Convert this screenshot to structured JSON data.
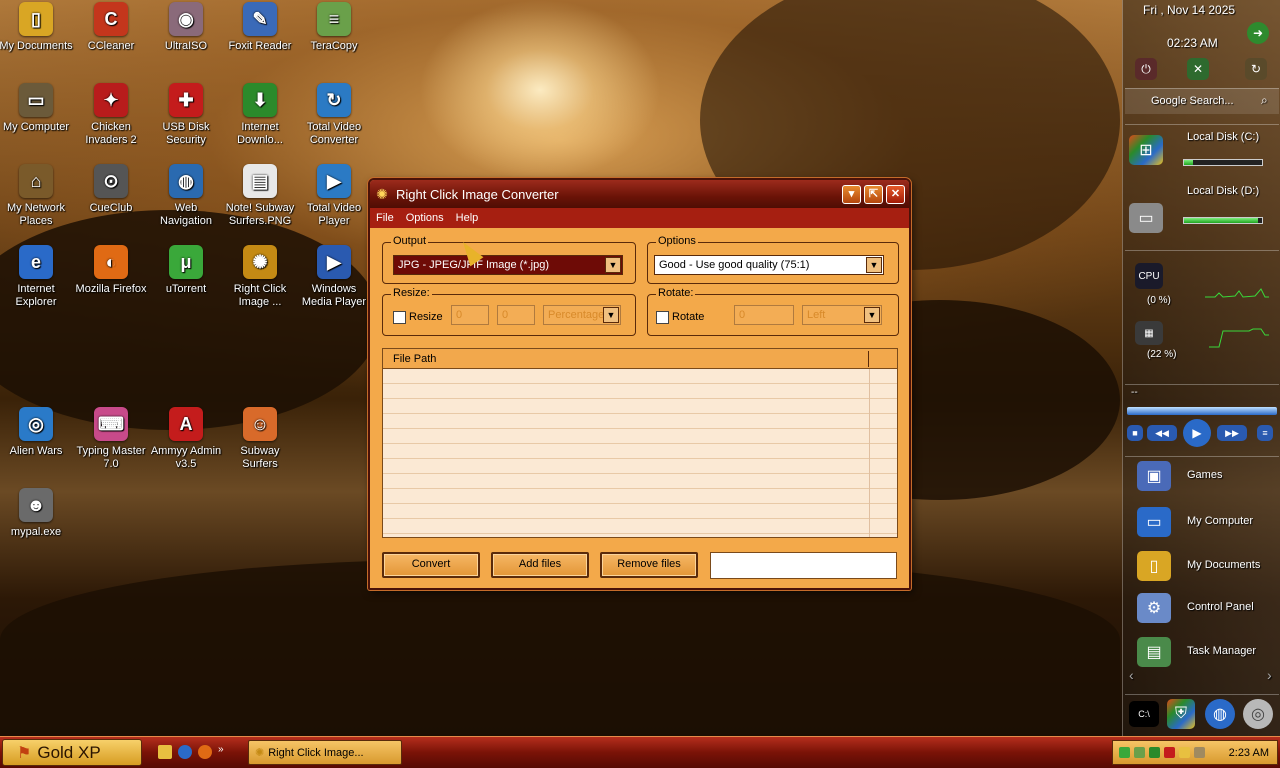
{
  "desktop": {
    "icons": [
      {
        "label": "My Documents",
        "glyph": "▯",
        "color": "#d9a624"
      },
      {
        "label": "CCleaner",
        "glyph": "C",
        "color": "#c4361c"
      },
      {
        "label": "UltraISO",
        "glyph": "◉",
        "color": "#8a6a7a"
      },
      {
        "label": "Foxit Reader",
        "glyph": "✎",
        "color": "#3a6ab8"
      },
      {
        "label": "TeraCopy",
        "glyph": "≡",
        "color": "#6aa04a"
      },
      {
        "label": "My Computer",
        "glyph": "▭",
        "color": "#6b5a3a"
      },
      {
        "label": "Chicken Invaders 2",
        "glyph": "✦",
        "color": "#b81c1c"
      },
      {
        "label": "USB Disk Security",
        "glyph": "✚",
        "color": "#c41c1c"
      },
      {
        "label": "Internet Downlo...",
        "glyph": "⬇",
        "color": "#2b8a2b"
      },
      {
        "label": "Total Video Converter",
        "glyph": "↻",
        "color": "#2b7ac4"
      },
      {
        "label": "My Network Places",
        "glyph": "⌂",
        "color": "#7a5a2a"
      },
      {
        "label": "CueClub",
        "glyph": "⊙",
        "color": "#555555"
      },
      {
        "label": "Web Navigation",
        "glyph": "◍",
        "color": "#2a6ab0"
      },
      {
        "label": "Note! Subway Surfers.PNG",
        "glyph": "▤",
        "color": "#e8e8e8"
      },
      {
        "label": "Total Video Player",
        "glyph": "▶",
        "color": "#2b7ac4"
      },
      {
        "label": "Internet Explorer",
        "glyph": "e",
        "color": "#2a6ac8"
      },
      {
        "label": "Mozilla Firefox",
        "glyph": "◐",
        "color": "#e06a14"
      },
      {
        "label": "uTorrent",
        "glyph": "μ",
        "color": "#3aa83a"
      },
      {
        "label": "Right Click Image ...",
        "glyph": "✺",
        "color": "#c48a14"
      },
      {
        "label": "Windows Media Player",
        "glyph": "▶",
        "color": "#2a5ab0"
      },
      {
        "label": "Alien Wars",
        "glyph": "◎",
        "color": "#2a7ac8"
      },
      {
        "label": "Typing Master 7.0",
        "glyph": "⌨",
        "color": "#c84a8a"
      },
      {
        "label": "Ammyy Admin v3.5",
        "glyph": "A",
        "color": "#c41c1c"
      },
      {
        "label": "Subway Surfers",
        "glyph": "☺",
        "color": "#d86a2a"
      },
      {
        "label": "mypal.exe",
        "glyph": "☻",
        "color": "#6a6a6a"
      }
    ]
  },
  "dialog": {
    "title": "Right Click Image Converter",
    "title_buttons": {
      "minimize": "▾",
      "maximize": "⇱",
      "close": "✕"
    },
    "menu": [
      "File",
      "Options",
      "Help"
    ],
    "output": {
      "legend": "Output",
      "value": "JPG - JPEG/JFIF Image (*.jpg)"
    },
    "options": {
      "legend": "Options",
      "value": "Good - Use good quality (75:1)"
    },
    "resize": {
      "legend": "Resize:",
      "checkbox_label": "Resize",
      "width": "0",
      "height": "0",
      "mode": "Percentage"
    },
    "rotate": {
      "legend": "Rotate:",
      "checkbox_label": "Rotate",
      "angle": "0",
      "direction": "Left"
    },
    "table": {
      "header": "File Path",
      "row_count": 11
    },
    "buttons": {
      "convert": "Convert",
      "add": "Add files",
      "remove": "Remove files"
    }
  },
  "sidebar": {
    "date": "Fri , Nov 14 2025",
    "time": "02:23 AM",
    "search_placeholder": "Google Search...",
    "disks": [
      {
        "label": "Local Disk (C:)",
        "fill": 0.12
      },
      {
        "label": "Local Disk (D:)",
        "fill": 0.95
      }
    ],
    "cpu": "(0 %)",
    "ram": "(22 %)",
    "media_label": "--",
    "links": [
      "Games",
      "My Computer",
      "My Documents",
      "Control Panel",
      "Task Manager"
    ]
  },
  "taskbar": {
    "start_label": "Gold XP",
    "chevron": "»",
    "task_label": "Right Click Image...",
    "clock": "2:23 AM"
  }
}
